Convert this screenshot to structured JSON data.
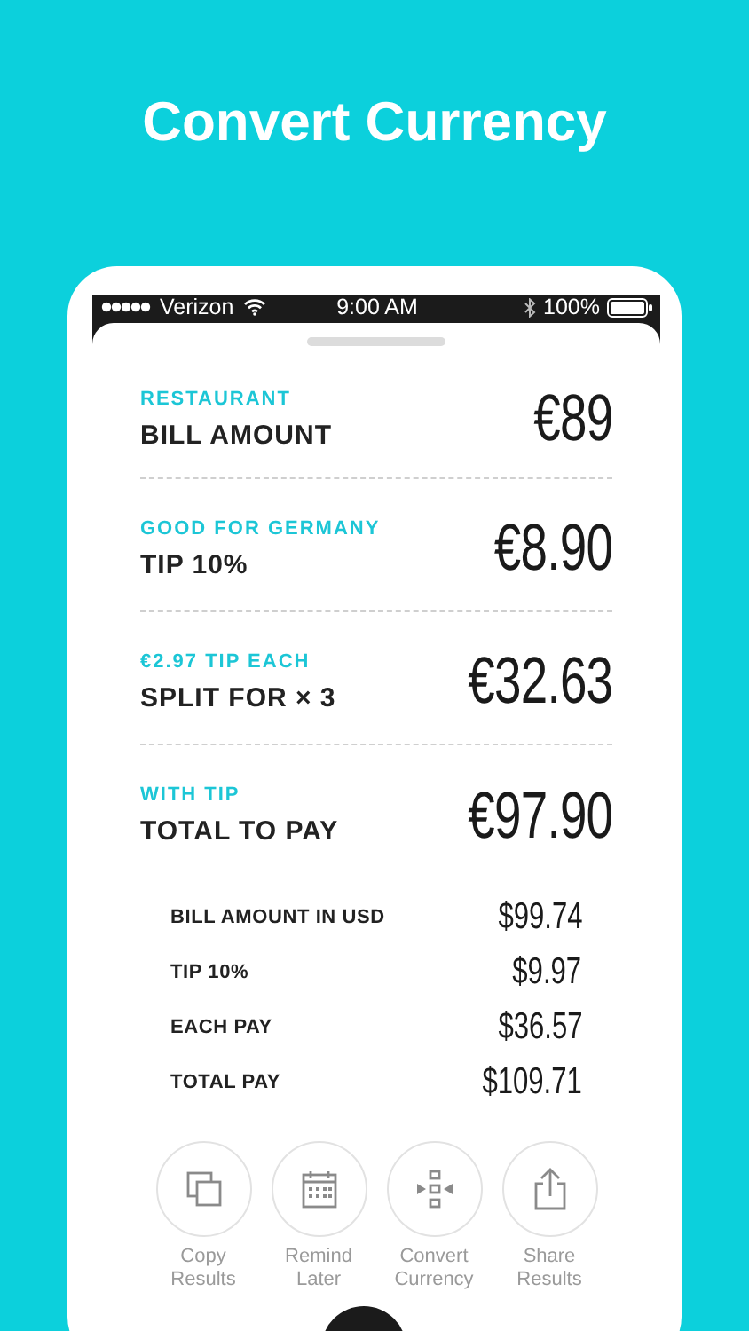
{
  "headline": "Convert Currency",
  "status_bar": {
    "carrier": "Verizon",
    "time": "9:00 AM",
    "battery": "100%"
  },
  "results": [
    {
      "caption": "RESTAURANT",
      "label": "BILL AMOUNT",
      "value": "€89"
    },
    {
      "caption": "GOOD FOR GERMANY",
      "label": "TIP 10%",
      "value": "€8.90"
    },
    {
      "caption": "€2.97 TIP EACH",
      "label": "SPLIT FOR × 3",
      "value": "€32.63"
    },
    {
      "caption": "WITH TIP",
      "label": "TOTAL TO PAY",
      "value": "€97.90"
    }
  ],
  "details": [
    {
      "label": "BILL AMOUNT IN USD",
      "value": "$99.74"
    },
    {
      "label": "TIP 10%",
      "value": "$9.97"
    },
    {
      "label": "EACH PAY",
      "value": "$36.57"
    },
    {
      "label": "TOTAL PAY",
      "value": "$109.71"
    }
  ],
  "actions": [
    {
      "kind": "copy",
      "label": "Copy Results"
    },
    {
      "kind": "calendar",
      "label": "Remind Later"
    },
    {
      "kind": "convert",
      "label": "Convert Currency"
    },
    {
      "kind": "share",
      "label": "Share Results"
    }
  ]
}
